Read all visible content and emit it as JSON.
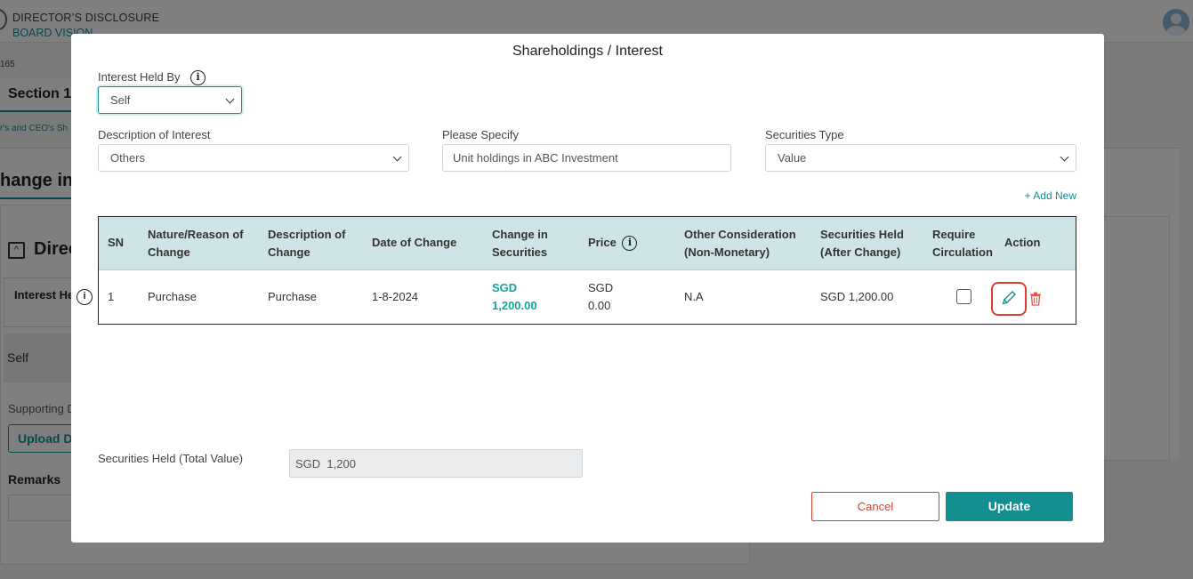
{
  "app": {
    "title": "DIRECTOR’S DISCLOSURE",
    "subtitle": "BOARD VISION"
  },
  "background": {
    "record_id": "165",
    "section_tab": "Section 1",
    "breadcrumb": "r's and CEO's Sh",
    "change_heading": "hange in",
    "collapse_symbol": "^",
    "director_heading": "Direc",
    "interest_header": "Interest He",
    "self_value": "Self",
    "supporting_label": "Supporting D",
    "upload_label": "Upload D",
    "remarks_label": "Remarks"
  },
  "modal": {
    "title": "Shareholdings / Interest",
    "interest_held_by": {
      "label": "Interest Held By",
      "value": "Self"
    },
    "description_of_interest": {
      "label": "Description of Interest",
      "value": "Others"
    },
    "please_specify": {
      "label": "Please Specify",
      "value": "Unit holdings in ABC Investment"
    },
    "securities_type": {
      "label": "Securities Type",
      "value": "Value"
    },
    "add_new": "+ Add New",
    "table": {
      "headers": {
        "sn": "SN",
        "nature_1": "Nature/Reason of",
        "nature_2": "Change",
        "desc_1": "Description of",
        "desc_2": "Change",
        "date": "Date of Change",
        "change_1": "Change in",
        "change_2": "Securities",
        "price": "Price",
        "other_1": "Other Consideration",
        "other_2": "(Non-Monetary)",
        "held_1": "Securities Held",
        "held_2": "(After Change)",
        "req_1": "Require",
        "req_2": "Circulation",
        "action": "Action"
      },
      "rows": [
        {
          "sn": "1",
          "nature": "Purchase",
          "description": "Purchase",
          "date": "1-8-2024",
          "change_currency": "SGD",
          "change_amount": "1,200.00",
          "price_currency": "SGD",
          "price_amount": "0.00",
          "other": "N.A",
          "held": "SGD 1,200.00",
          "require_circulation": false
        }
      ]
    },
    "total": {
      "label": "Securities Held (Total Value)",
      "value": "SGD  1,200"
    },
    "buttons": {
      "cancel": "Cancel",
      "update": "Update"
    }
  },
  "colors": {
    "accent": "#138f92",
    "header_bg": "#cfe4e6",
    "danger": "#d9402c",
    "green_text": "#14a89a"
  },
  "icons": [
    "info-icon",
    "chevron-down-icon",
    "edit-pencil-icon",
    "trash-icon",
    "user-avatar-icon"
  ]
}
